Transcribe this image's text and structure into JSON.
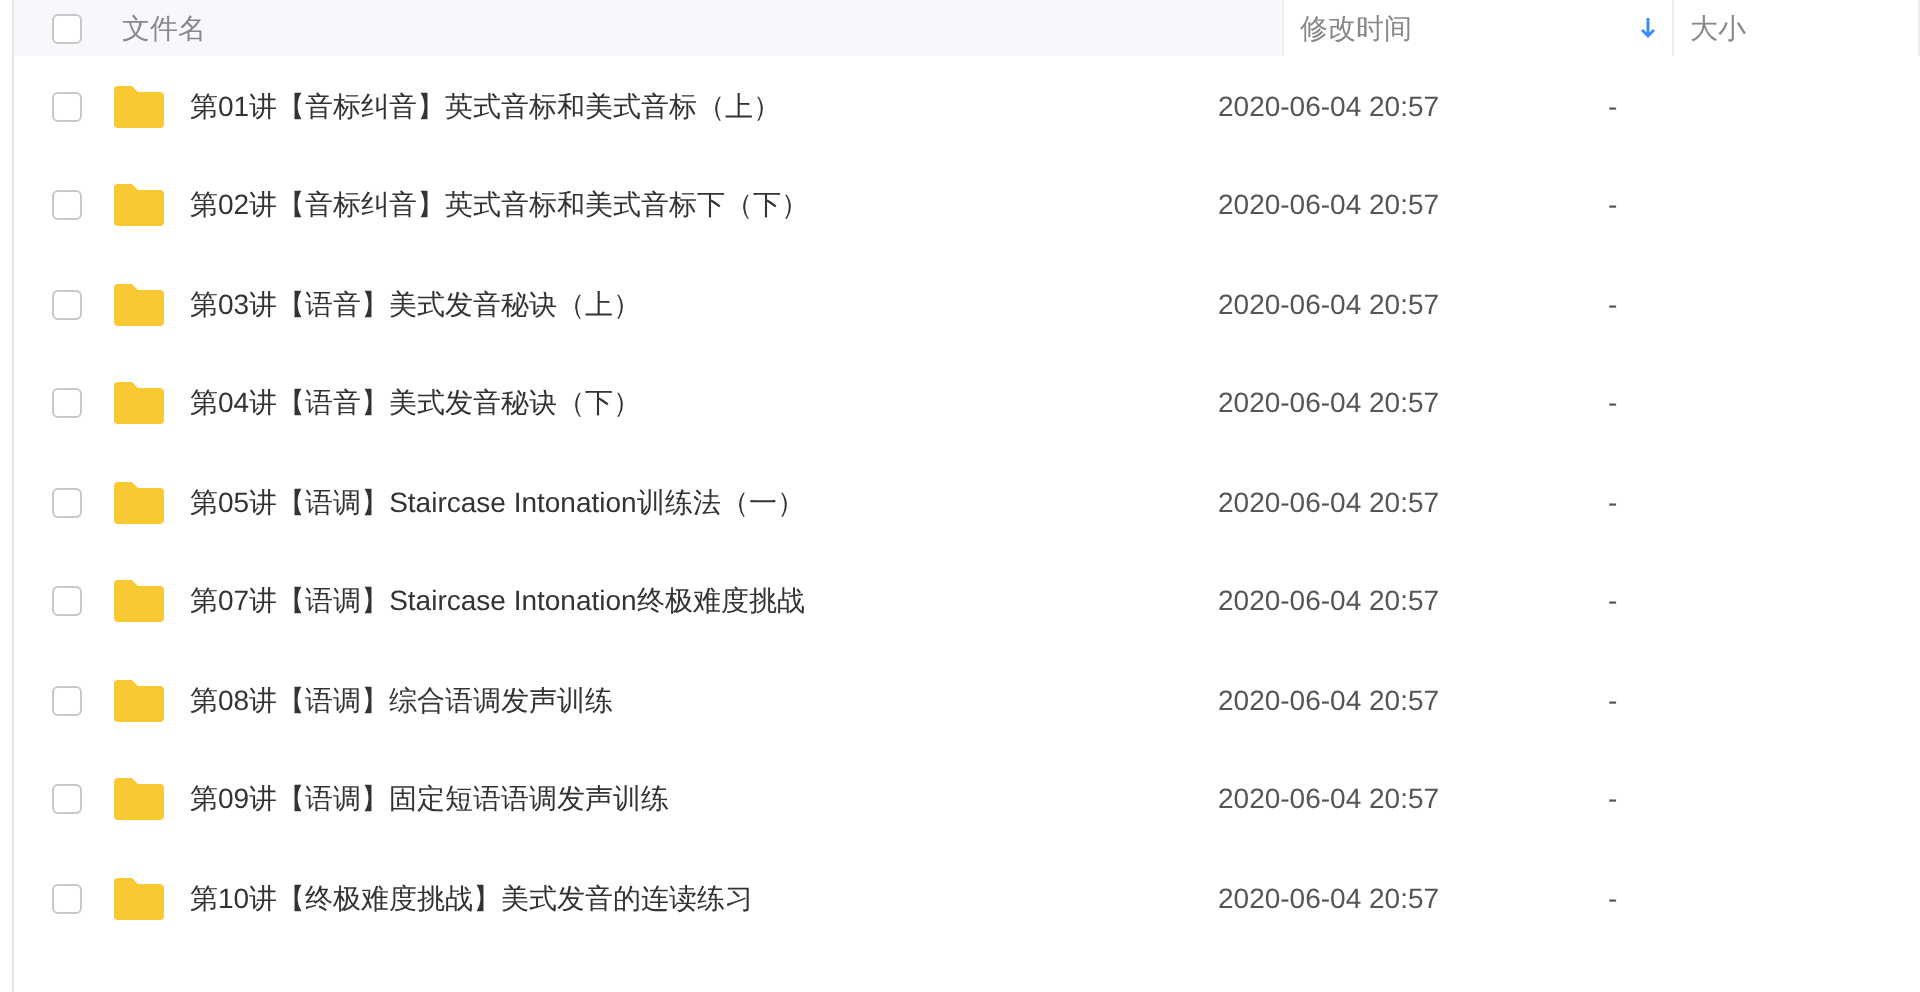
{
  "header": {
    "select_all_checked": false,
    "columns": [
      {
        "label": "文件名",
        "sorted": false
      },
      {
        "label": "修改时间",
        "sorted": true
      },
      {
        "label": "大小",
        "sorted": false
      }
    ]
  },
  "rows": [
    {
      "name": "第01讲【音标纠音】英式音标和美式音标（上）",
      "modified": "2020-06-04 20:57",
      "size": "-",
      "checked": false
    },
    {
      "name": "第02讲【音标纠音】英式音标和美式音标下（下）",
      "modified": "2020-06-04 20:57",
      "size": "-",
      "checked": false
    },
    {
      "name": "第03讲【语音】美式发音秘诀（上）",
      "modified": "2020-06-04 20:57",
      "size": "-",
      "checked": false
    },
    {
      "name": "第04讲【语音】美式发音秘诀（下）",
      "modified": "2020-06-04 20:57",
      "size": "-",
      "checked": false
    },
    {
      "name": "第05讲【语调】Staircase Intonation训练法（一）",
      "modified": "2020-06-04 20:57",
      "size": "-",
      "checked": false
    },
    {
      "name": "第07讲【语调】Staircase Intonation终极难度挑战",
      "modified": "2020-06-04 20:57",
      "size": "-",
      "checked": false
    },
    {
      "name": "第08讲【语调】综合语调发声训练",
      "modified": "2020-06-04 20:57",
      "size": "-",
      "checked": false
    },
    {
      "name": "第09讲【语调】固定短语语调发声训练",
      "modified": "2020-06-04 20:57",
      "size": "-",
      "checked": false
    },
    {
      "name": "第10讲【终极难度挑战】美式发音的连读练习",
      "modified": "2020-06-04 20:57",
      "size": "-",
      "checked": false
    }
  ]
}
